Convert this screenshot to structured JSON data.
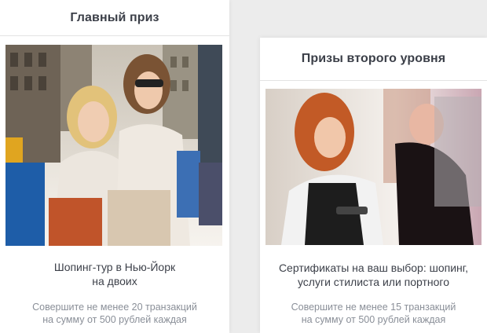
{
  "main_prize": {
    "title": "Главный приз",
    "image_alt": "shopping-women-photo",
    "name_line1": "Шопинг-тур в Нью-Йорк",
    "name_line2": "на двоих",
    "cond_line1": "Совершите не менее 20 транзакций",
    "cond_line2": "на сумму от 500 рублей каждая"
  },
  "second_prizes": {
    "title": "Призы второго уровня",
    "image_alt": "hair-stylist-photo",
    "name_line1": "Сертификаты на ваш выбор: шопинг,",
    "name_line2": "услуги стилиста или портного",
    "cond_line1": "Совершите не менее 15 транзакций",
    "cond_line2": "на сумму от 500 рублей каждая"
  }
}
